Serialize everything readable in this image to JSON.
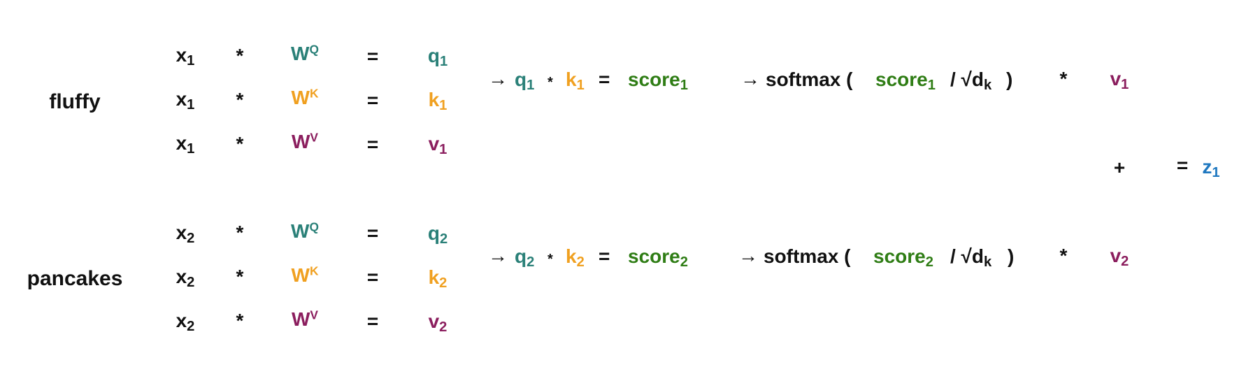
{
  "colors": {
    "query": "#2a8078",
    "key": "#f0a020",
    "value": "#8b1e5e",
    "score": "#2f7d15",
    "output": "#1f78c0",
    "text": "#111111"
  },
  "tokens": [
    {
      "word": "fluffy",
      "rows": [
        {
          "x": "x",
          "x_sub": "1",
          "op": "*",
          "w": "W",
          "w_sup": "Q",
          "eq": "=",
          "out": "q",
          "out_sub": "1",
          "kind": "query"
        },
        {
          "x": "x",
          "x_sub": "1",
          "op": "*",
          "w": "W",
          "w_sup": "K",
          "eq": "=",
          "out": "k",
          "out_sub": "1",
          "kind": "key"
        },
        {
          "x": "x",
          "x_sub": "1",
          "op": "*",
          "w": "W",
          "w_sup": "V",
          "eq": "=",
          "out": "v",
          "out_sub": "1",
          "kind": "value"
        }
      ],
      "flow": {
        "arrow1": "→",
        "q": "q",
        "q_sub": "1",
        "dot": "*",
        "k": "k",
        "k_sub": "1",
        "eq": "=",
        "score": "score",
        "score_sub": "1",
        "arrow2": "→",
        "softmax": "softmax (",
        "score2": "score",
        "score2_sub": "1",
        "div": "/ √d",
        "div_sub": "k",
        "close": ")",
        "mul": "*",
        "v": "v",
        "v_sub": "1"
      }
    },
    {
      "word": "pancakes",
      "rows": [
        {
          "x": "x",
          "x_sub": "2",
          "op": "*",
          "w": "W",
          "w_sup": "Q",
          "eq": "=",
          "out": "q",
          "out_sub": "2",
          "kind": "query"
        },
        {
          "x": "x",
          "x_sub": "2",
          "op": "*",
          "w": "W",
          "w_sup": "K",
          "eq": "=",
          "out": "k",
          "out_sub": "2",
          "kind": "key"
        },
        {
          "x": "x",
          "x_sub": "2",
          "op": "*",
          "w": "W",
          "w_sup": "V",
          "eq": "=",
          "out": "v",
          "out_sub": "2",
          "kind": "value"
        }
      ],
      "flow": {
        "arrow1": "→",
        "q": "q",
        "q_sub": "2",
        "dot": "*",
        "k": "k",
        "k_sub": "2",
        "eq": "=",
        "score": "score",
        "score_sub": "2",
        "arrow2": "→",
        "softmax": "softmax (",
        "score2": "score",
        "score2_sub": "2",
        "div": "/ √d",
        "div_sub": "k",
        "close": ")",
        "mul": "*",
        "v": "v",
        "v_sub": "2"
      }
    }
  ],
  "sum": {
    "plus": "+",
    "eq": "=",
    "z": "z",
    "z_sub": "1"
  }
}
